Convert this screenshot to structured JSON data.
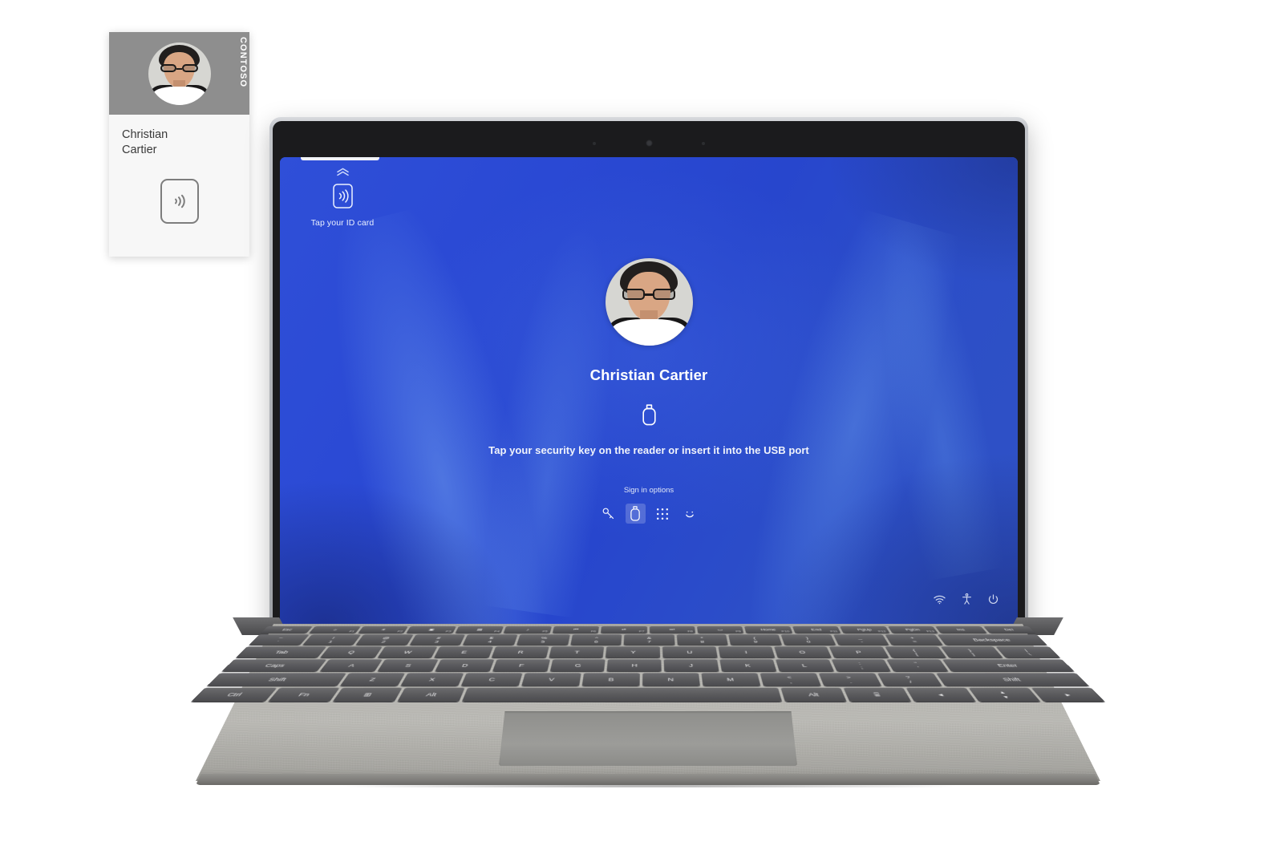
{
  "badge": {
    "org": "CONTOSO",
    "name_line1": "Christian",
    "name_line2": "Cartier",
    "nfc_icon": "nfc-contactless-icon",
    "card_bg": "#f7f7f7",
    "photo_band_bg": "#8e8e8e"
  },
  "screen": {
    "tap_id": {
      "chevron_icon": "chevron-double-up-icon",
      "nfc_icon": "nfc-contactless-icon",
      "label": "Tap your ID card"
    },
    "login": {
      "avatar_icon": "user-avatar-photo",
      "user_name": "Christian Cartier",
      "security_key_icon": "security-key-icon",
      "prompt": "Tap your security key on the reader or insert it into the USB port",
      "signin_options_label": "Sign in options",
      "options": [
        {
          "id": "password",
          "icon": "key-icon",
          "selected": false
        },
        {
          "id": "security-key",
          "icon": "security-key-icon",
          "selected": true
        },
        {
          "id": "pin",
          "icon": "pin-keypad-icon",
          "selected": false
        },
        {
          "id": "face",
          "icon": "face-smile-icon",
          "selected": false
        }
      ]
    },
    "tray": [
      {
        "id": "network",
        "icon": "wifi-icon"
      },
      {
        "id": "accessibility",
        "icon": "accessibility-icon"
      },
      {
        "id": "power",
        "icon": "power-icon"
      }
    ],
    "accent_blue": "#2a49d4",
    "text_white": "#ffffff"
  },
  "keyboard": {
    "fn_row": [
      {
        "label": "Esc",
        "sub": ""
      },
      {
        "label": "☼",
        "sub": "F1"
      },
      {
        "label": "☀",
        "sub": "F2"
      },
      {
        "label": "▣",
        "sub": "F3"
      },
      {
        "label": "▤",
        "sub": "F4"
      },
      {
        "label": "♪",
        "sub": "F5"
      },
      {
        "label": "⏮",
        "sub": "F6"
      },
      {
        "label": "⏯",
        "sub": "F7"
      },
      {
        "label": "⏭",
        "sub": "F8"
      },
      {
        "label": "▭",
        "sub": "F9"
      },
      {
        "label": "Home",
        "sub": "F10"
      },
      {
        "label": "End",
        "sub": "F11"
      },
      {
        "label": "PgUp",
        "sub": "F12"
      },
      {
        "label": "PgDn",
        "sub": "F13"
      },
      {
        "label": "Ins",
        "sub": ""
      },
      {
        "label": "Del",
        "sub": ""
      }
    ],
    "row_numbers": [
      {
        "top": "~",
        "bot": "`"
      },
      {
        "top": "!",
        "bot": "1"
      },
      {
        "top": "@",
        "bot": "2"
      },
      {
        "top": "#",
        "bot": "3"
      },
      {
        "top": "$",
        "bot": "4"
      },
      {
        "top": "%",
        "bot": "5"
      },
      {
        "top": "^",
        "bot": "6"
      },
      {
        "top": "&",
        "bot": "7"
      },
      {
        "top": "*",
        "bot": "8"
      },
      {
        "top": "(",
        "bot": "9"
      },
      {
        "top": ")",
        "bot": "0"
      },
      {
        "top": "_",
        "bot": "-"
      },
      {
        "top": "+",
        "bot": "="
      }
    ],
    "row_numbers_last": "Backspace",
    "row_q_first": "Tab",
    "row_q": [
      "Q",
      "W",
      "E",
      "R",
      "T",
      "Y",
      "U",
      "I",
      "O",
      "P"
    ],
    "row_q_brackets": [
      {
        "top": "{",
        "bot": "["
      },
      {
        "top": "}",
        "bot": "]"
      },
      {
        "top": "|",
        "bot": "\\"
      }
    ],
    "row_a_first": "Caps",
    "row_a": [
      "A",
      "S",
      "D",
      "F",
      "G",
      "H",
      "J",
      "K",
      "L"
    ],
    "row_a_punct": [
      {
        "top": ":",
        "bot": ";"
      },
      {
        "top": "\"",
        "bot": "'"
      }
    ],
    "row_a_last": "Enter",
    "row_z_first": "Shift",
    "row_z": [
      "Z",
      "X",
      "C",
      "V",
      "B",
      "N",
      "M"
    ],
    "row_z_punct": [
      {
        "top": "<",
        "bot": ","
      },
      {
        "top": ">",
        "bot": "."
      },
      {
        "top": "?",
        "bot": "/"
      }
    ],
    "row_z_last": "Shift",
    "row_bottom": [
      {
        "label": "Ctrl",
        "w": "w15"
      },
      {
        "label": "Fn",
        "w": "w125"
      },
      {
        "label": "⊞",
        "w": "w125"
      },
      {
        "label": "Alt",
        "w": "w125"
      },
      {
        "label": "",
        "w": "w65"
      },
      {
        "label": "Alt",
        "w": "w125"
      },
      {
        "label": "⌸",
        "w": "w125"
      },
      {
        "label": "◂",
        "w": "w125"
      }
    ],
    "arrow_up": "▴",
    "arrow_down": "▾",
    "arrow_right": "▸"
  }
}
